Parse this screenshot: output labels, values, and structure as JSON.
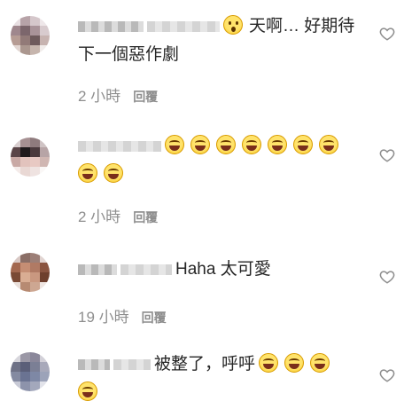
{
  "comments": [
    {
      "text": "天啊… 好期待",
      "text2": "下一個惡作劇",
      "time": "2 小時",
      "reply": "回覆"
    },
    {
      "text": "",
      "time": "2 小時",
      "reply": "回覆"
    },
    {
      "text": "Haha 太可愛",
      "time": "19 小時",
      "reply": "回覆"
    },
    {
      "text": "被整了，呼呼",
      "time": "",
      "reply": ""
    }
  ],
  "icons": {
    "emoji_surprise": "hushed-face-emoji",
    "emoji_laugh": "face-with-tears-of-joy-emoji",
    "like": "heart-outline-icon"
  },
  "colors": {
    "text": "#262626",
    "meta": "#8e8e8e"
  }
}
